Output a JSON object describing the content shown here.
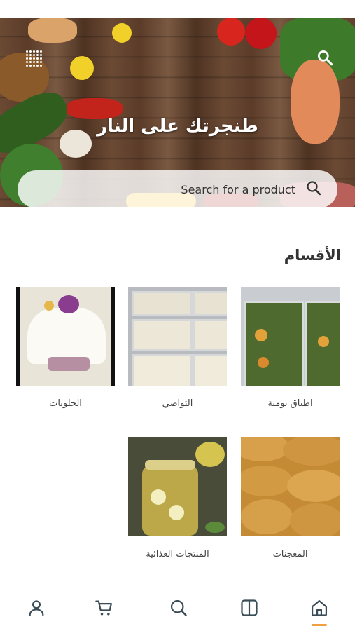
{
  "hero": {
    "brand_title": "طنجرتك على النار",
    "search_placeholder": "Search for a product"
  },
  "section": {
    "title": "الأقسام"
  },
  "categories": [
    {
      "label": "اطباق يومية",
      "icon": "stuffed-vegetables-image"
    },
    {
      "label": "التواصي",
      "icon": "trays-image"
    },
    {
      "label": "الحلويات",
      "icon": "cake-image"
    },
    {
      "label": "المعجنات",
      "icon": "pastries-image"
    },
    {
      "label": "المنتجات الغذائية",
      "icon": "pickles-jar-image"
    }
  ],
  "bottom_nav": {
    "items": [
      "profile-icon",
      "cart-icon",
      "search-icon",
      "catalog-icon",
      "home-icon"
    ],
    "active": "home-icon"
  },
  "colors": {
    "accent": "#f0a040",
    "nav_icon": "#3a4d57",
    "title_text": "#333333"
  }
}
